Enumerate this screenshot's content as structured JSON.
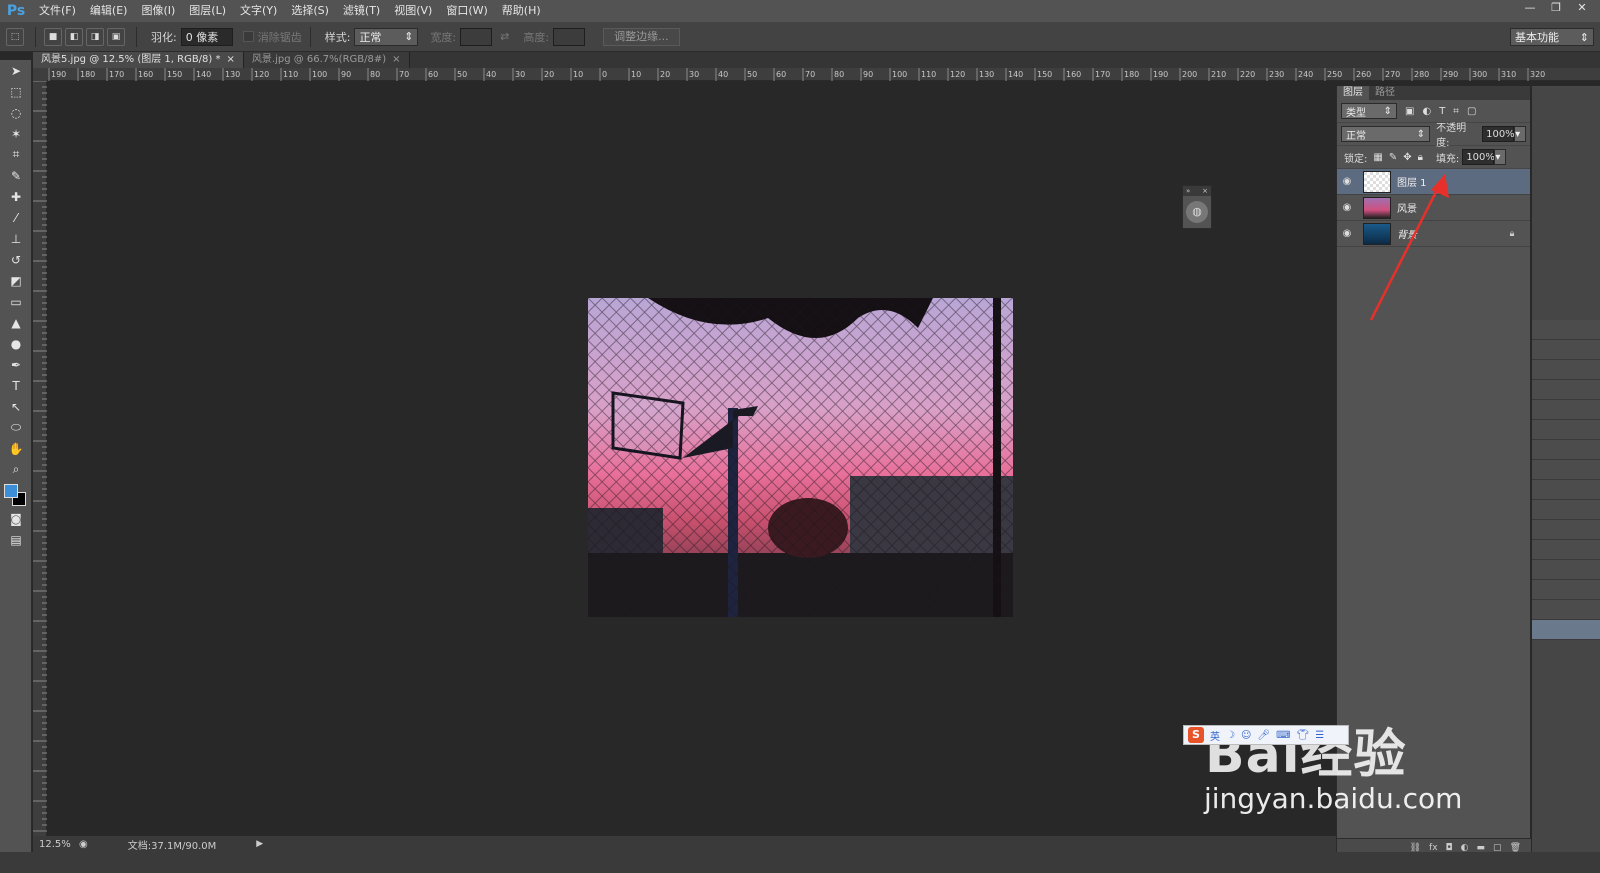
{
  "app": {
    "logo": "Ps"
  },
  "menu": [
    "文件(F)",
    "编辑(E)",
    "图像(I)",
    "图层(L)",
    "文字(Y)",
    "选择(S)",
    "滤镜(T)",
    "视图(V)",
    "窗口(W)",
    "帮助(H)"
  ],
  "window_controls": [
    "—",
    "❐",
    "✕"
  ],
  "options": {
    "feather_label": "羽化:",
    "feather_value": "0 像素",
    "antialias_label": "消除锯齿",
    "style_label": "样式:",
    "style_value": "正常",
    "width_label": "宽度:",
    "height_label": "高度:",
    "refine_button": "调整边缘...",
    "workspace": "基本功能"
  },
  "tabs": [
    {
      "label": "风景5.jpg @ 12.5% (图层 1, RGB/8) *",
      "close": "×"
    },
    {
      "label": "风景.jpg @ 66.7%(RGB/8#)",
      "close": "×"
    }
  ],
  "ruler_top_labels": [
    "190",
    "180",
    "170",
    "160",
    "150",
    "140",
    "130",
    "120",
    "110",
    "100",
    "90",
    "80",
    "70",
    "60",
    "50",
    "40",
    "30",
    "20",
    "10",
    "0",
    "10",
    "20",
    "30",
    "40",
    "50",
    "60",
    "70",
    "80",
    "90",
    "100",
    "110",
    "120",
    "130",
    "140",
    "150",
    "160",
    "170",
    "180",
    "190",
    "200",
    "210",
    "220",
    "230",
    "240",
    "250",
    "260",
    "270",
    "280",
    "290",
    "300",
    "310",
    "320"
  ],
  "layers_panel": {
    "tabs": [
      "图层",
      "路径"
    ],
    "filter_type": "类型",
    "blend_mode": "正常",
    "opacity_label": "不透明度:",
    "opacity_value": "100%",
    "lock_label": "锁定:",
    "fill_label": "填充:",
    "fill_value": "100%",
    "layers": [
      {
        "name": "图层 1",
        "selected": true
      },
      {
        "name": "风景",
        "selected": false
      },
      {
        "name": "背景",
        "selected": false,
        "locked": true
      }
    ],
    "bottom_icons": [
      "link-icon",
      "fx-icon",
      "mask-icon",
      "adjustment-icon",
      "folder-icon",
      "new-layer-icon",
      "trash-icon"
    ]
  },
  "status": {
    "zoom": "12.5%",
    "doc_info": "文档:37.1M/90.0M"
  },
  "watermark": {
    "logo": "Bai经验",
    "url": "jingyan.baidu.com"
  },
  "colors": {
    "foreground": "#3c8fd6",
    "background": "#000000",
    "annotation_arrow": "#e8302a"
  }
}
